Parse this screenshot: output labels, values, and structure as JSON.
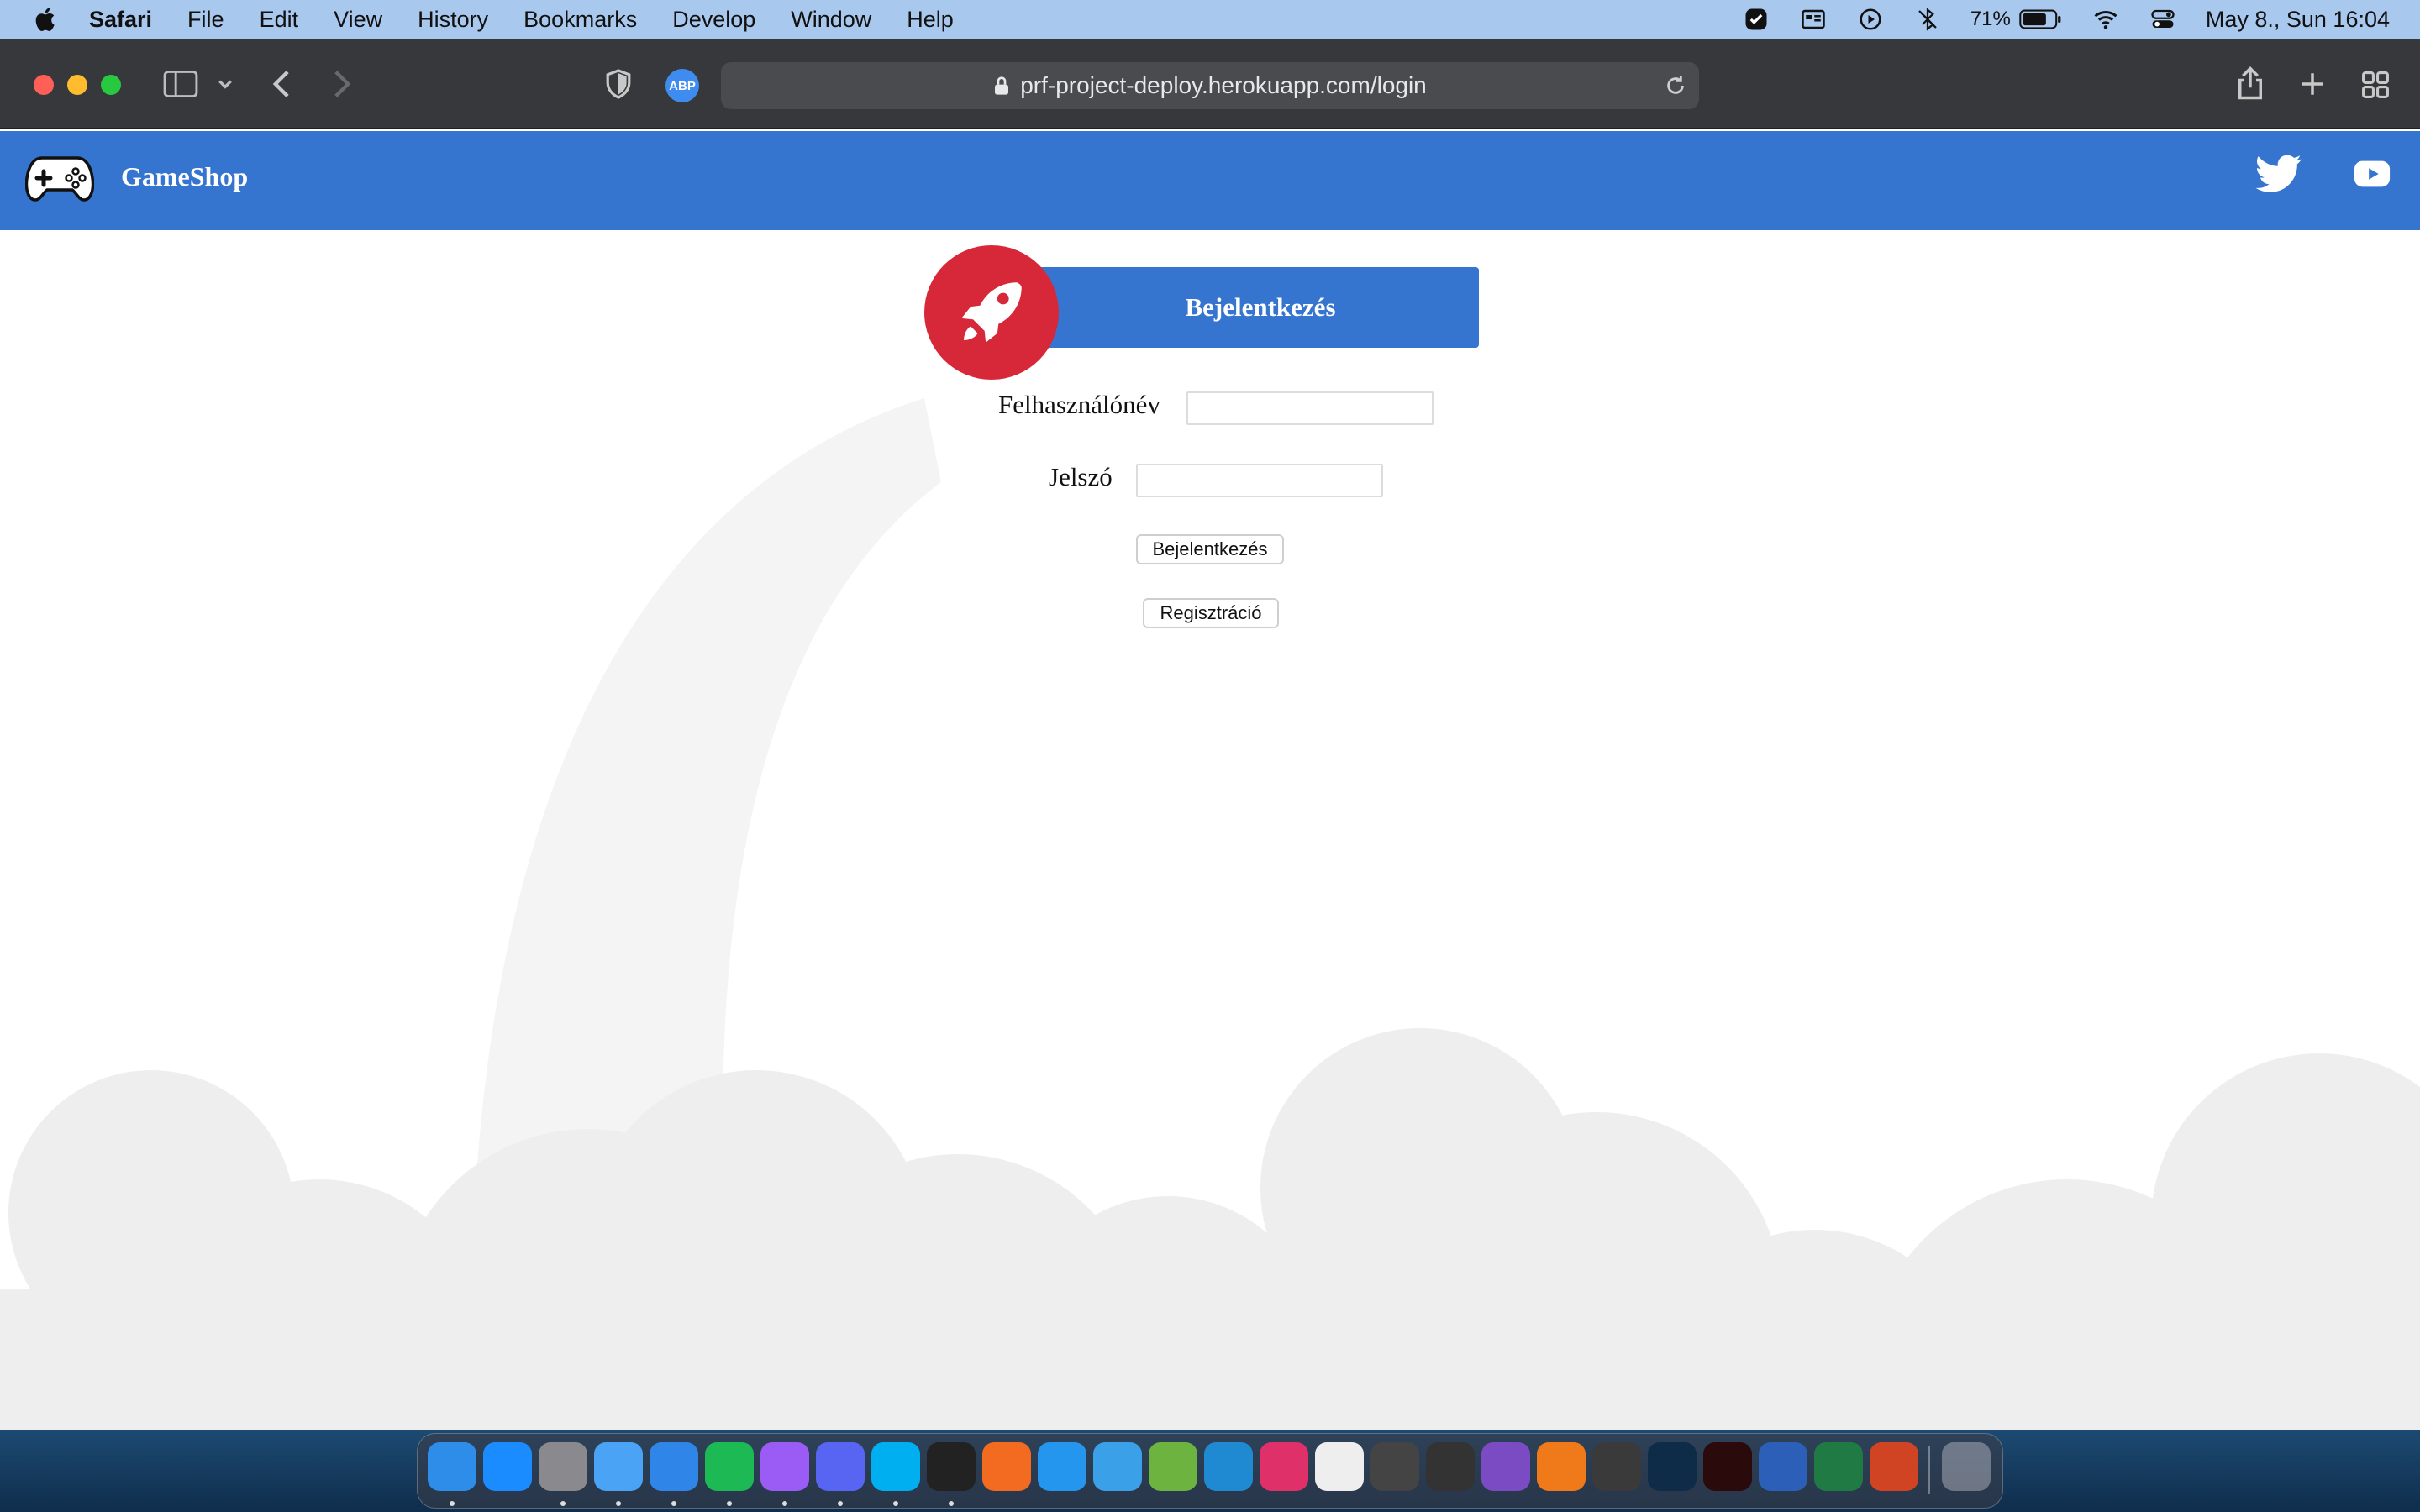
{
  "menubar": {
    "app_name": "Safari",
    "items": [
      "File",
      "Edit",
      "View",
      "History",
      "Bookmarks",
      "Develop",
      "Window",
      "Help"
    ],
    "battery_percent": "71%",
    "datetime": "May 8., Sun  16:04"
  },
  "browser": {
    "url": "prf-project-deploy.herokuapp.com/login",
    "extension_label": "ABP"
  },
  "site": {
    "brand": "GameShop",
    "brand_color": "#3675cf",
    "accent_color": "#d62839"
  },
  "login": {
    "title": "Bejelentkezés",
    "username_label": "Felhasználónév",
    "username_value": "",
    "password_label": "Jelszó",
    "password_value": "",
    "login_button": "Bejelentkezés",
    "register_button": "Regisztráció"
  },
  "dock": {
    "apps": [
      {
        "icon": "finder-icon",
        "color": "#2e8de8",
        "running": true
      },
      {
        "icon": "app-store-icon",
        "color": "#1a8cff",
        "running": false
      },
      {
        "icon": "system-preferences-icon",
        "color": "#8a8a8e",
        "running": true
      },
      {
        "icon": "mail-icon",
        "color": "#4aa3f5",
        "running": true
      },
      {
        "icon": "safari-icon",
        "color": "#2f86e8",
        "running": true
      },
      {
        "icon": "spotify-icon",
        "color": "#1db954",
        "running": true
      },
      {
        "icon": "messenger-icon",
        "color": "#9b5cf6",
        "running": true
      },
      {
        "icon": "discord-icon",
        "color": "#5865f2",
        "running": true
      },
      {
        "icon": "skype-icon",
        "color": "#00aff0",
        "running": true
      },
      {
        "icon": "terminal-icon",
        "color": "#222222",
        "running": true
      },
      {
        "icon": "sketch-icon",
        "color": "#f26b21",
        "running": false
      },
      {
        "icon": "docker-icon",
        "color": "#2496ed",
        "running": false
      },
      {
        "icon": "fork-icon",
        "color": "#3aa0e8",
        "running": false
      },
      {
        "icon": "notes-icon",
        "color": "#6cb33f",
        "running": false
      },
      {
        "icon": "vscode-icon",
        "color": "#1f8ad2",
        "running": false
      },
      {
        "icon": "intellij-icon",
        "color": "#e0306a",
        "running": false
      },
      {
        "icon": "xcode-instruments-icon",
        "color": "#eeeeee",
        "running": false
      },
      {
        "icon": "unity-icon",
        "color": "#444444",
        "running": false
      },
      {
        "icon": "unity-hub-icon",
        "color": "#333333",
        "running": false
      },
      {
        "icon": "visual-studio-icon",
        "color": "#7b4bc4",
        "running": false
      },
      {
        "icon": "sourcetree-icon",
        "color": "#f07a1a",
        "running": false
      },
      {
        "icon": "final-cut-icon",
        "color": "#3a3a3a",
        "running": false
      },
      {
        "icon": "photoshop-icon",
        "color": "#0e2c48",
        "running": false
      },
      {
        "icon": "acrobat-icon",
        "color": "#2a0a0a",
        "running": false
      },
      {
        "icon": "word-icon",
        "color": "#2b5fb8",
        "running": false
      },
      {
        "icon": "excel-icon",
        "color": "#1f7a44",
        "running": false
      },
      {
        "icon": "powerpoint-icon",
        "color": "#d04423",
        "running": false
      }
    ]
  }
}
